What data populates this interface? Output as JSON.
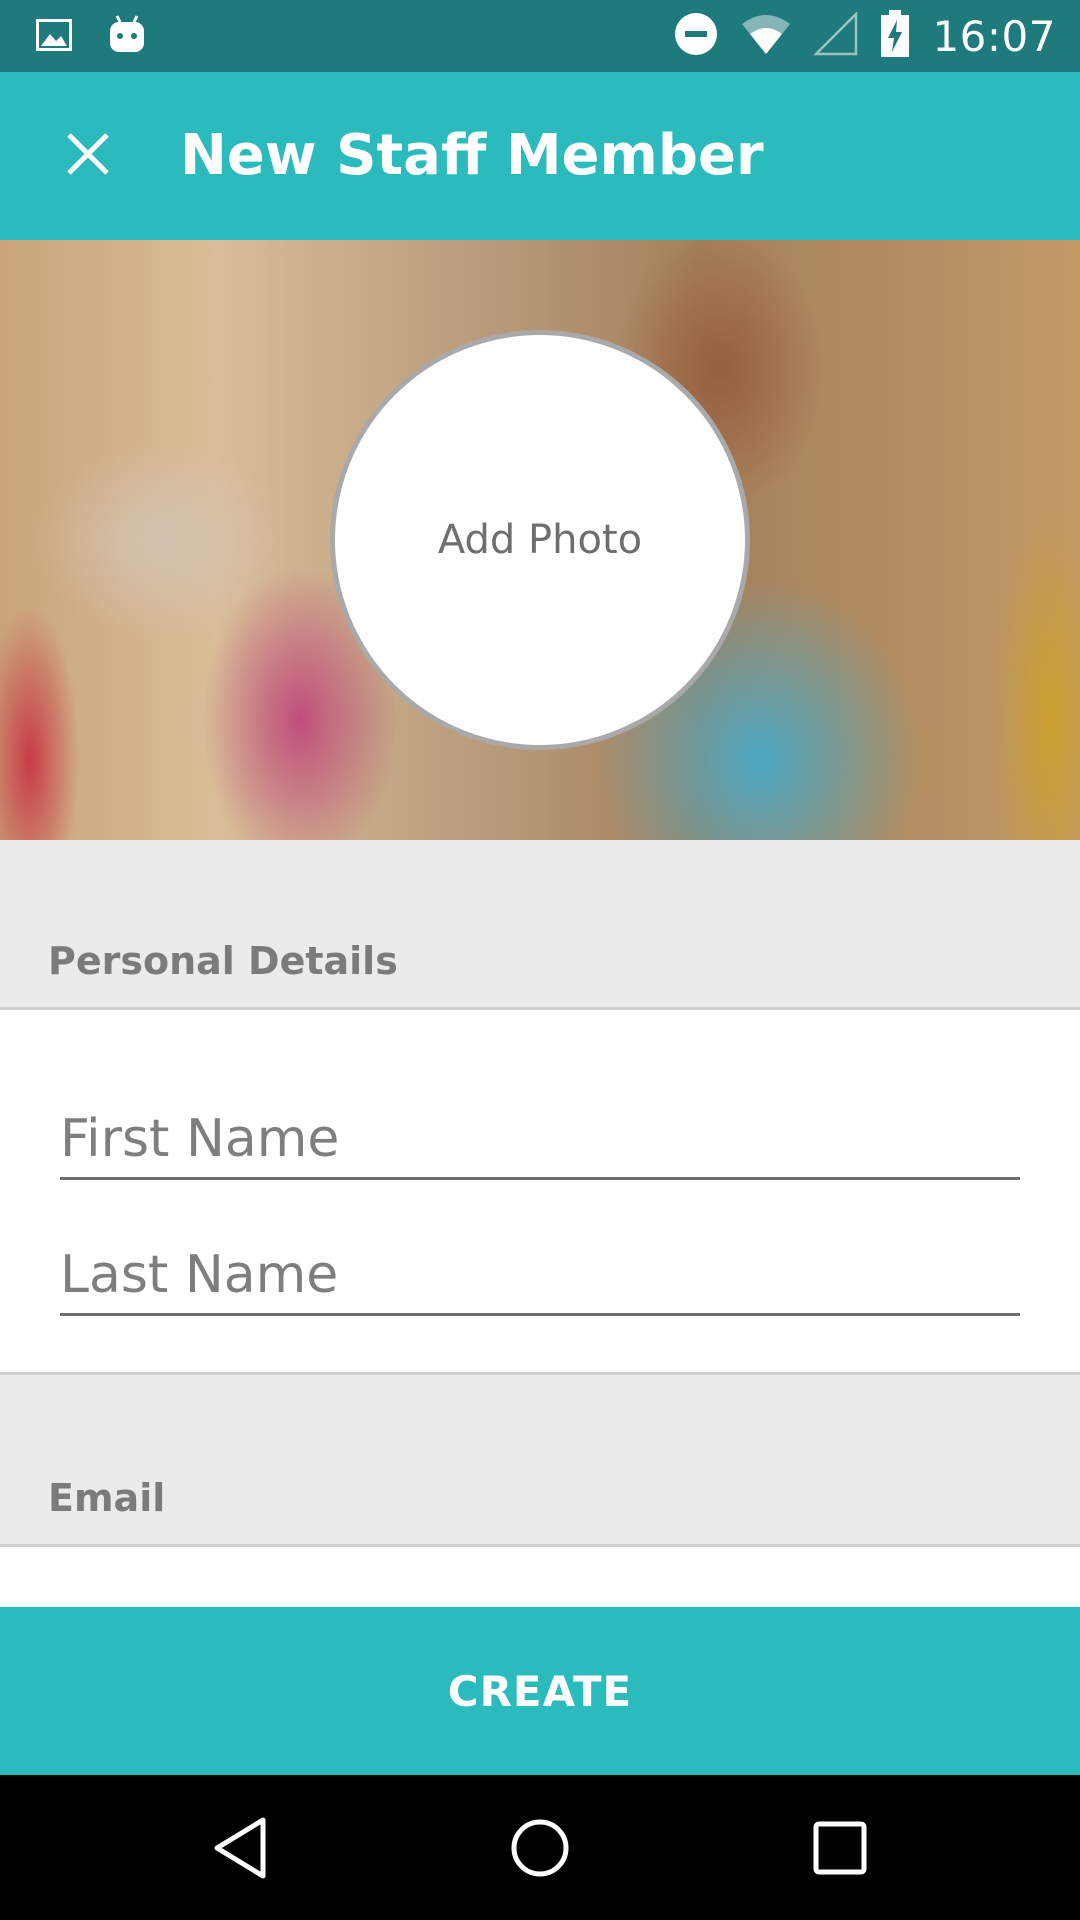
{
  "status_bar": {
    "time": "16:07",
    "icons": [
      "image-icon",
      "android-icon",
      "do-not-disturb-icon",
      "wifi-icon",
      "cell-signal-icon",
      "battery-charging-icon"
    ]
  },
  "app_bar": {
    "title": "New Staff Member",
    "close_icon": "close-icon"
  },
  "hero": {
    "add_photo_label": "Add Photo"
  },
  "sections": {
    "personal_details": "Personal Details",
    "email": "Email"
  },
  "form": {
    "first_name": {
      "placeholder": "First Name",
      "value": ""
    },
    "last_name": {
      "placeholder": "Last Name",
      "value": ""
    }
  },
  "actions": {
    "create_label": "CREATE"
  },
  "navigation": {
    "back_icon": "back-icon",
    "home_icon": "home-icon",
    "recents_icon": "recents-icon"
  },
  "colors": {
    "status_bar": "#1f7a7c",
    "accent": "#2bbbbd",
    "section_bg": "#ebebeb",
    "section_text": "#7b7b7b"
  }
}
